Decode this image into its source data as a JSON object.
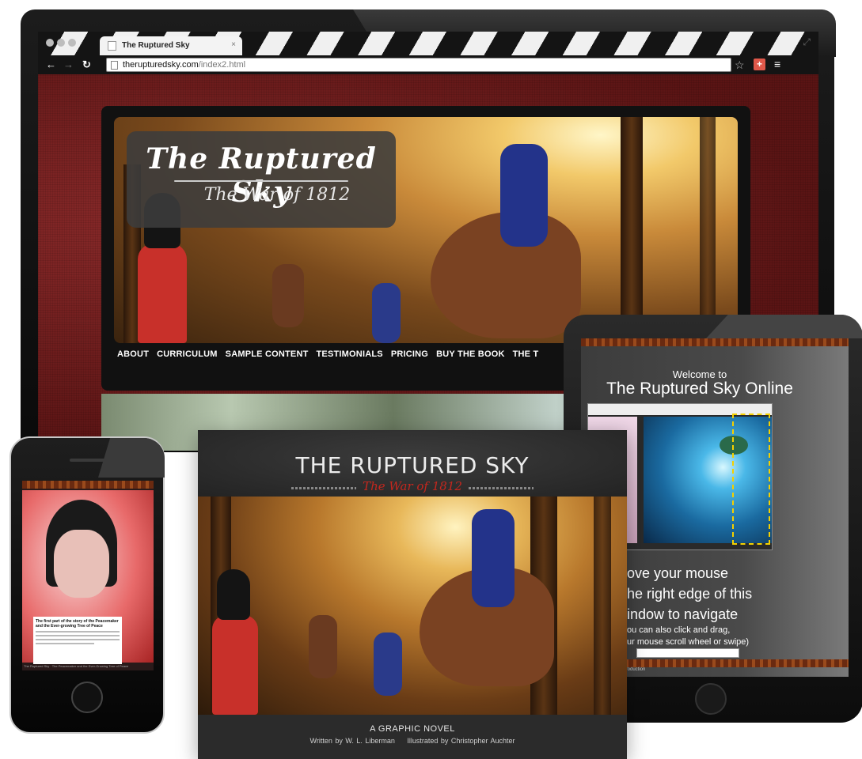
{
  "browser": {
    "tab_title": "The Ruptured Sky",
    "url_host": "therupturedsky.com",
    "url_path": "/index2.html"
  },
  "site": {
    "logo_title": "The Ruptured Sky",
    "logo_subtitle": "The War of 1812",
    "nav": [
      "ABOUT",
      "CURRICULUM",
      "SAMPLE CONTENT",
      "TESTIMONIALS",
      "PRICING",
      "BUY THE BOOK",
      "THE T"
    ]
  },
  "tablet": {
    "welcome": "Welcome to",
    "title": "The Ruptured Sky Online",
    "instruction_lines": [
      "ove your mouse",
      "he right edge of this",
      "indow to navigate"
    ],
    "instruction_small": [
      "ou can also click and drag,",
      "ur mouse scroll wheel or swipe)"
    ],
    "footer": "Introduction"
  },
  "phone": {
    "caption_title": "The first part of the story of the Peacemaker and the Ever-growing Tree of Peace",
    "footer": "The Ruptured Sky · The Peacemaker and the Ever-Growing Tree of Peace"
  },
  "book": {
    "title": "THE RUPTURED SKY",
    "subtitle": "The War of 1812",
    "kicker": "A GRAPHIC NOVEL",
    "written_by": "Written by W. L. Liberman",
    "illustrated_by": "Illustrated by Christopher Auchter"
  },
  "colors": {
    "accent_red": "#c4271e",
    "page_maroon": "#6b1a1a",
    "device_black": "#111111"
  }
}
